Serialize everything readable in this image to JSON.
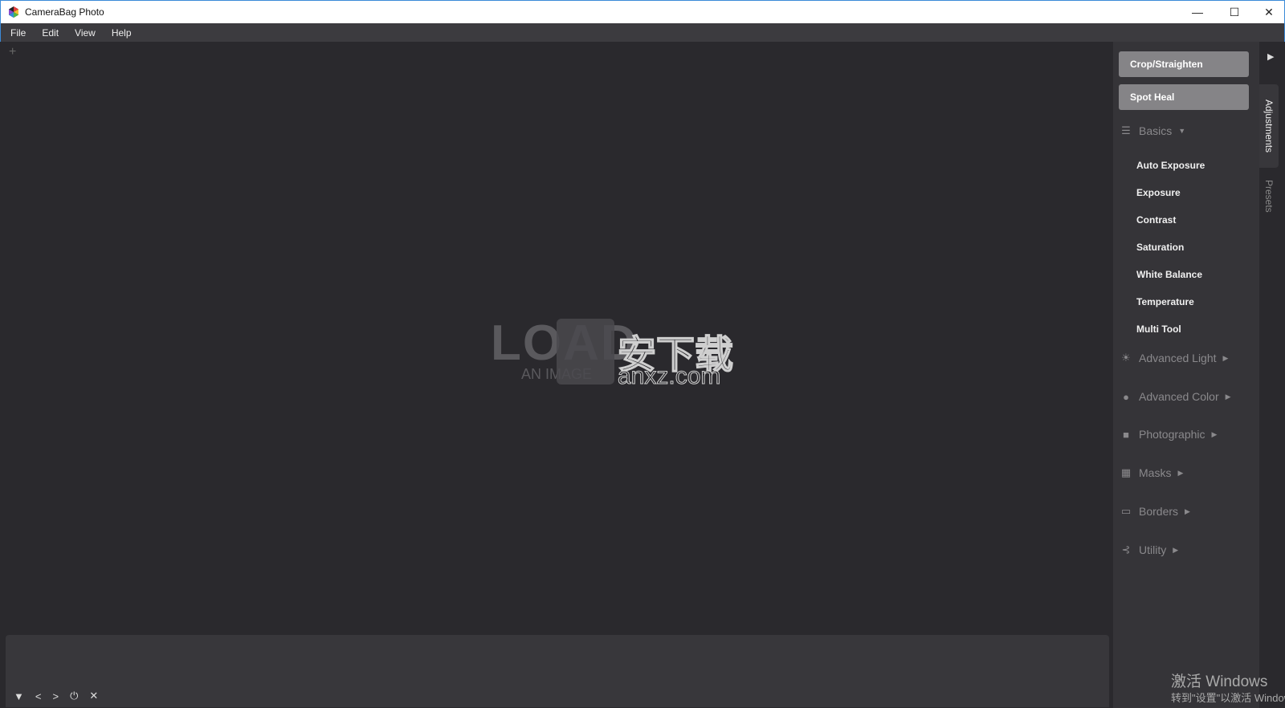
{
  "titlebar": {
    "title": "CameraBag Photo"
  },
  "menu": [
    "File",
    "Edit",
    "View",
    "Help"
  ],
  "canvas": {
    "load_text": "LOAD",
    "load_sub": "AN IMAGE",
    "watermark_cn": "安下载",
    "watermark_url": "anxz.com"
  },
  "panel": {
    "crop_label": "Crop/Straighten",
    "heal_label": "Spot Heal",
    "basics": {
      "label": "Basics",
      "items": [
        "Auto Exposure",
        "Exposure",
        "Contrast",
        "Saturation",
        "White Balance",
        "Temperature",
        "Multi Tool"
      ]
    },
    "sections": [
      {
        "label": "Advanced Light",
        "icon": "sun-icon"
      },
      {
        "label": "Advanced Color",
        "icon": "color-circles-icon"
      },
      {
        "label": "Photographic",
        "icon": "camera-icon"
      },
      {
        "label": "Masks",
        "icon": "checker-icon"
      },
      {
        "label": "Borders",
        "icon": "rectangle-icon"
      },
      {
        "label": "Utility",
        "icon": "fork-icon"
      }
    ]
  },
  "tabs": {
    "adjustments": "Adjustments",
    "presets": "Presets"
  },
  "system": {
    "activate": "激活 Windows",
    "activate_sub": "转到\"设置\"以激活 Windows。"
  }
}
